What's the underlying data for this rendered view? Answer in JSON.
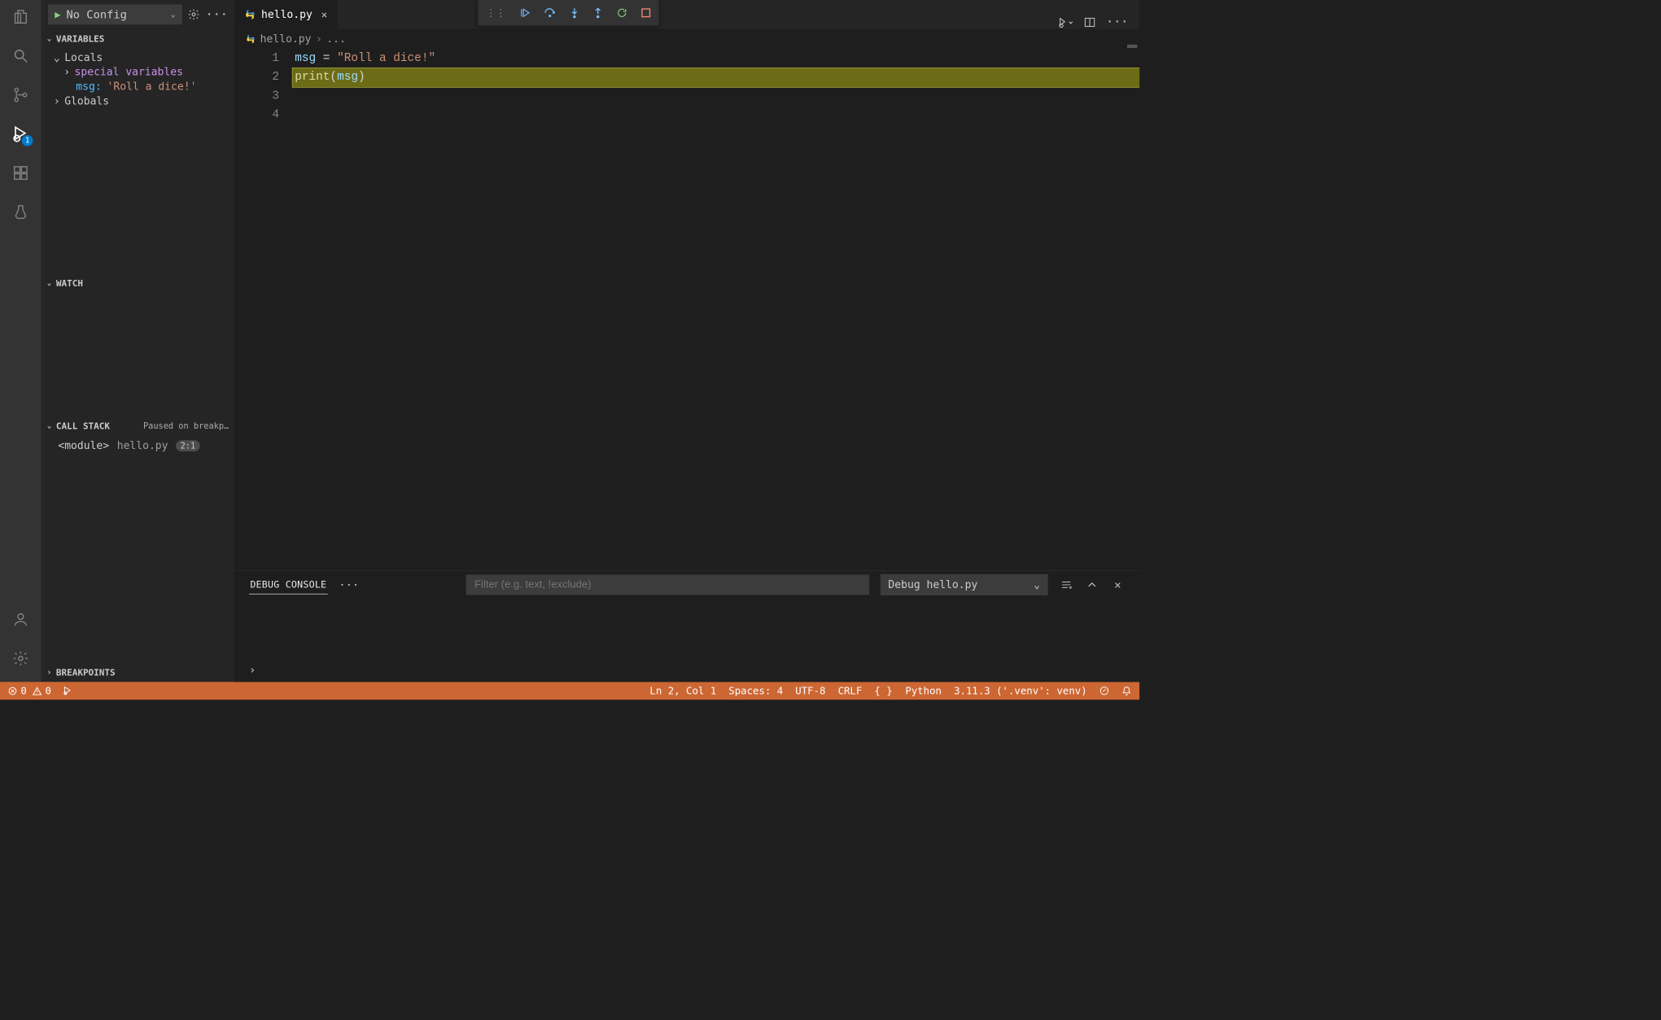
{
  "sidebar_head": {
    "config_label": "No Config",
    "gear_icon": "gear",
    "dots_icon": "ellipsis"
  },
  "sections": {
    "variables": {
      "title": "VARIABLES",
      "scopes": [
        {
          "name": "Locals",
          "expanded": true
        },
        {
          "name": "Globals",
          "expanded": false
        }
      ],
      "special_label": "special variables",
      "items": [
        {
          "key": "msg:",
          "value": "'Roll a dice!'"
        }
      ]
    },
    "watch": {
      "title": "WATCH"
    },
    "callstack": {
      "title": "CALL STACK",
      "status": "Paused on breakp…",
      "frames": [
        {
          "name": "<module>",
          "file": "hello.py",
          "pos": "2:1"
        }
      ]
    },
    "breakpoints": {
      "title": "BREAKPOINTS"
    }
  },
  "tab": {
    "title": "hello.py"
  },
  "breadcrumbs": {
    "file": "hello.py",
    "rest": "..."
  },
  "debug_toolbar": {
    "continue": "continue",
    "stepover": "step-over",
    "stepinto": "step-into",
    "stepout": "step-out",
    "restart": "restart",
    "stop": "stop"
  },
  "code": {
    "lines": [
      {
        "n": "1",
        "segments": [
          {
            "t": "msg",
            "c": "v-var"
          },
          {
            "t": " = ",
            "c": "v-op"
          },
          {
            "t": "\"Roll a dice!\"",
            "c": "v-str"
          }
        ],
        "current": false
      },
      {
        "n": "2",
        "segments": [
          {
            "t": "print",
            "c": "v-fn"
          },
          {
            "t": "(",
            "c": "v-par"
          },
          {
            "t": "msg",
            "c": "v-arg"
          },
          {
            "t": ")",
            "c": "v-par"
          }
        ],
        "current": true
      },
      {
        "n": "3",
        "segments": [],
        "current": false
      },
      {
        "n": "4",
        "segments": [],
        "current": false
      }
    ]
  },
  "panel": {
    "tab": "DEBUG CONSOLE",
    "filter_placeholder": "Filter (e.g. text, !exclude)",
    "session": "Debug hello.py"
  },
  "statusbar": {
    "errors": "0",
    "warnings": "0",
    "ln_col": "Ln 2, Col 1",
    "spaces": "Spaces: 4",
    "encoding": "UTF-8",
    "eol": "CRLF",
    "lang_brackets": "{ }",
    "language": "Python",
    "venv": "3.11.3 ('.venv': venv)"
  },
  "activitybar": {
    "debug_badge": "1"
  }
}
